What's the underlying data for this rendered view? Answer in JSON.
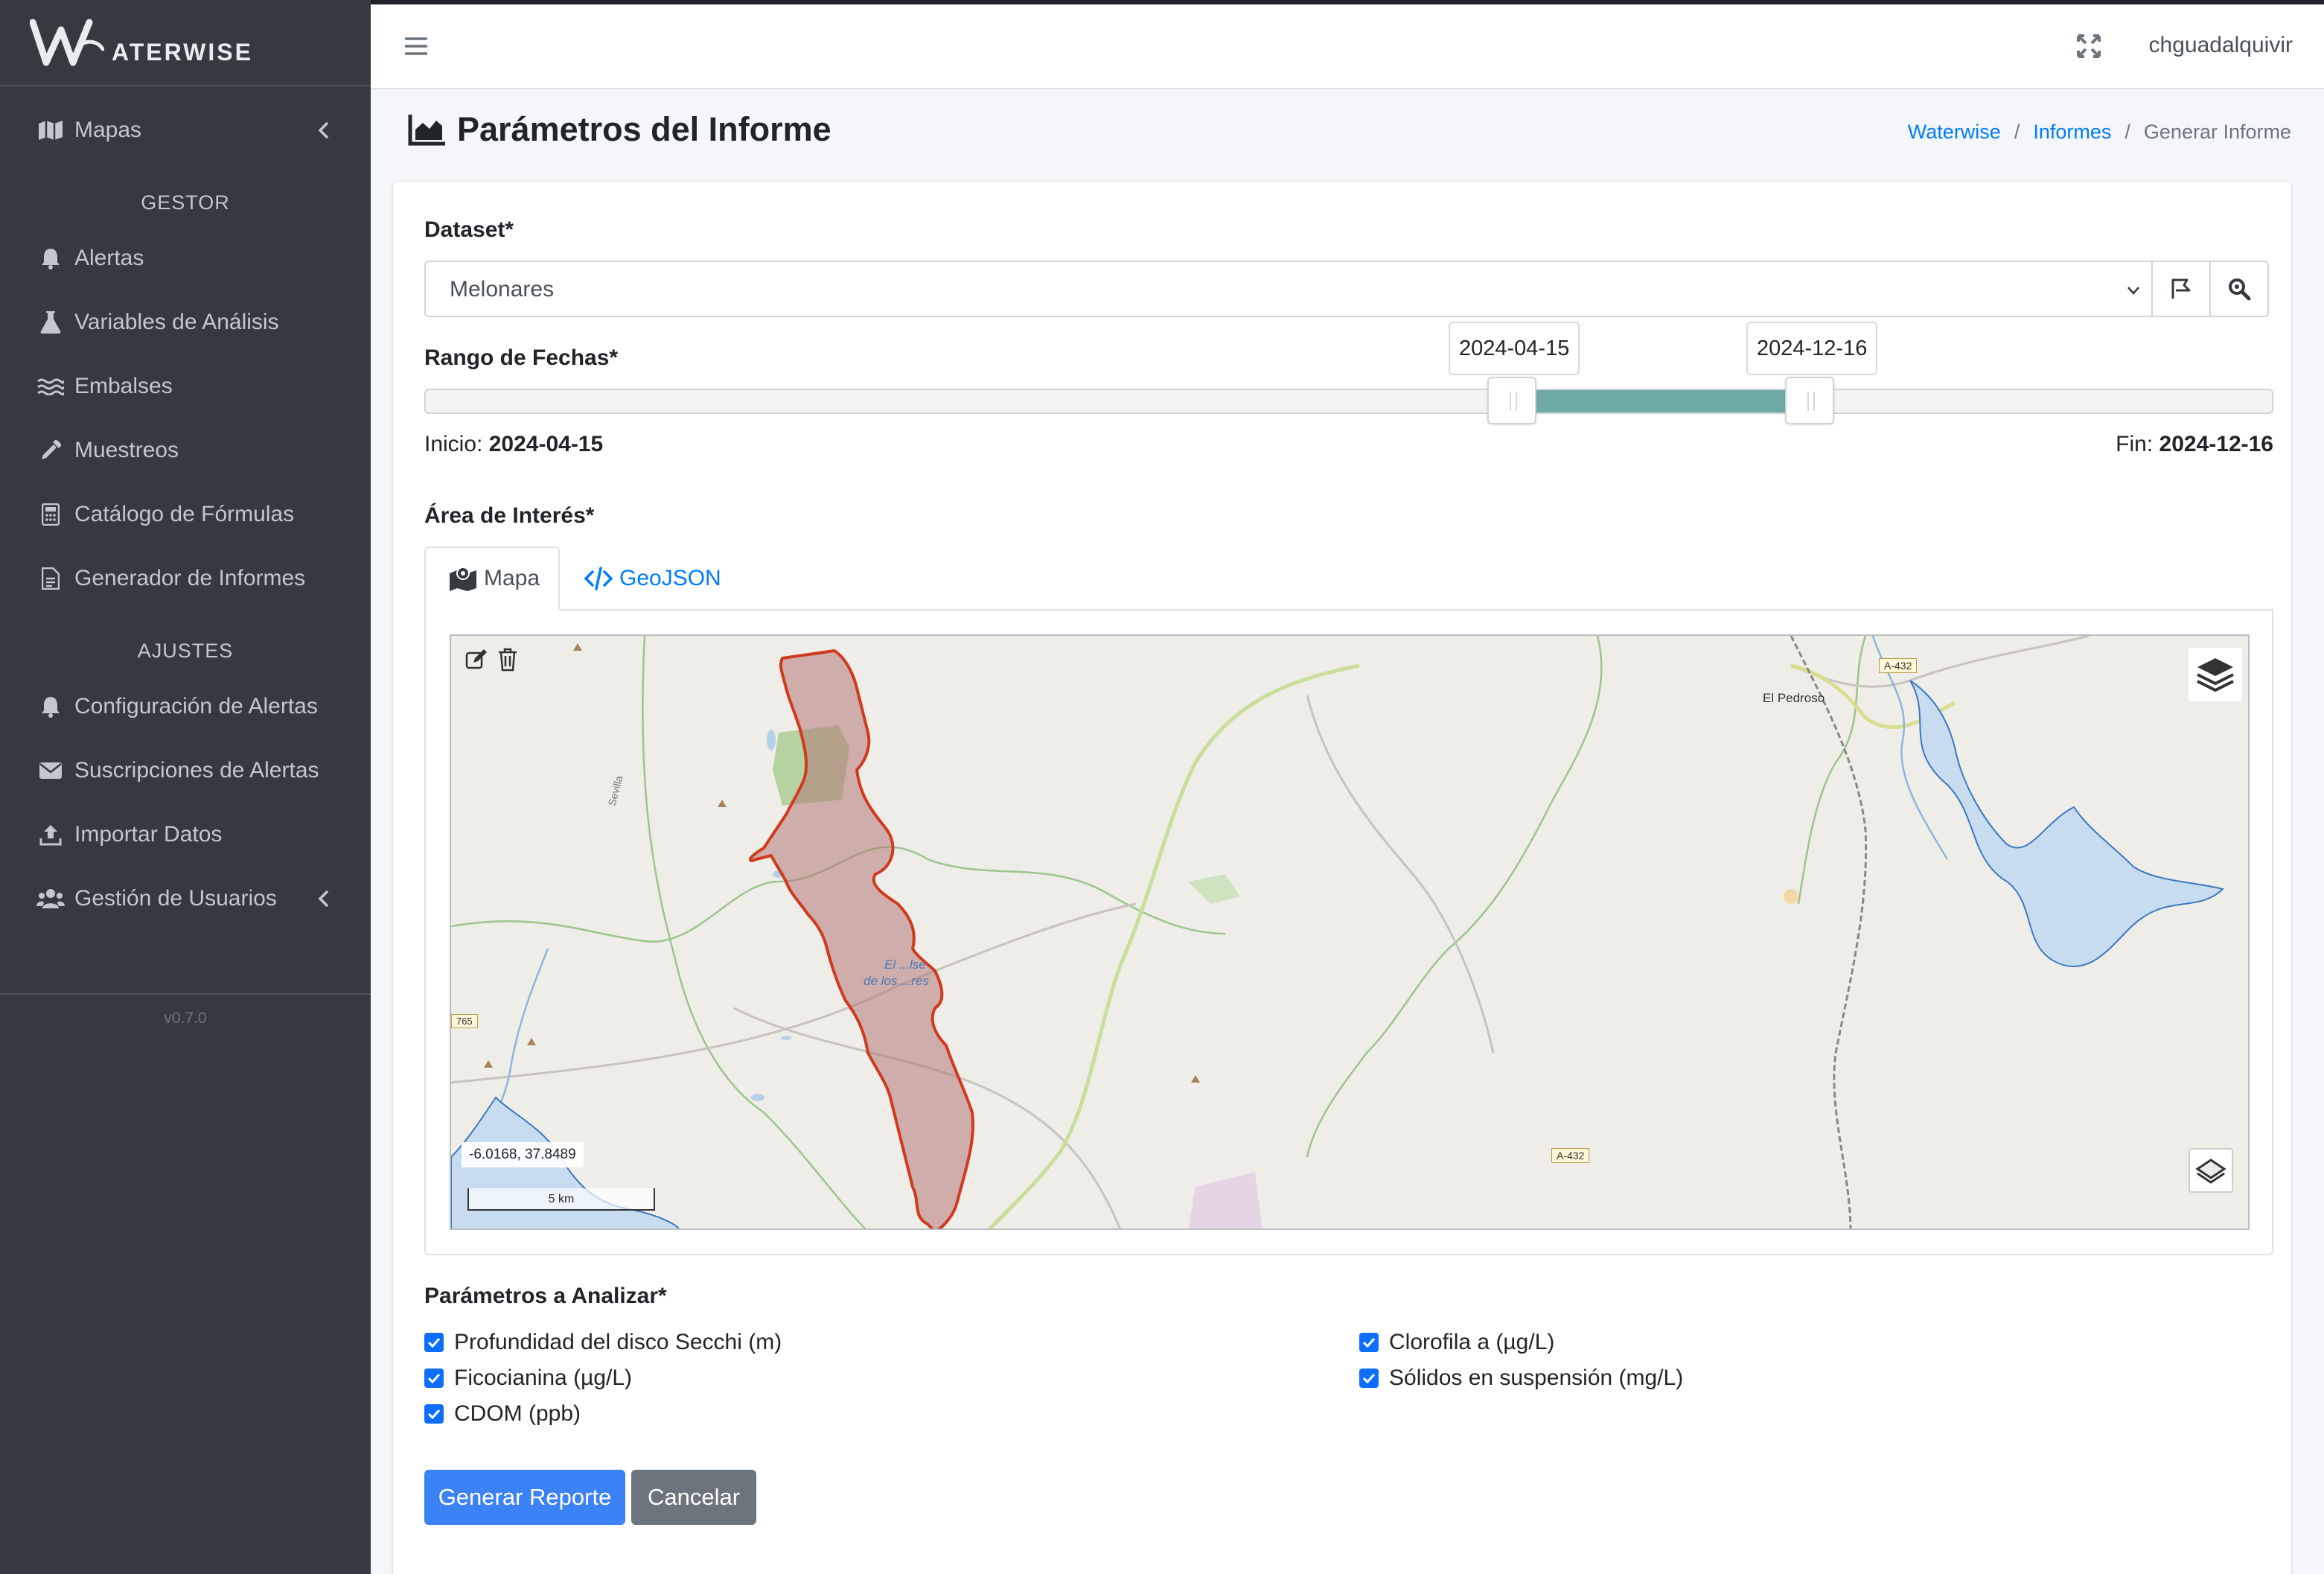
{
  "brand": {
    "name": "ATERWISE"
  },
  "sidebar": {
    "items_top": [
      {
        "label": "Mapas",
        "icon": "map-icon"
      }
    ],
    "section_gestor": "GESTOR",
    "items_gestor": [
      {
        "label": "Alertas",
        "icon": "bell-icon"
      },
      {
        "label": "Variables de Análisis",
        "icon": "flask-icon"
      },
      {
        "label": "Embalses",
        "icon": "water-icon"
      },
      {
        "label": "Muestreos",
        "icon": "eyedropper-icon"
      },
      {
        "label": "Catálogo de Fórmulas",
        "icon": "calculator-icon"
      },
      {
        "label": "Generador de Informes",
        "icon": "file-icon"
      }
    ],
    "section_ajustes": "AJUSTES",
    "items_ajustes": [
      {
        "label": "Configuración de Alertas",
        "icon": "bell-icon"
      },
      {
        "label": "Suscripciones de Alertas",
        "icon": "envelope-icon"
      },
      {
        "label": "Importar Datos",
        "icon": "upload-icon"
      },
      {
        "label": "Gestión de Usuarios",
        "icon": "users-icon"
      }
    ],
    "version": "v0.7.0"
  },
  "navbar": {
    "username": "chguadalquivir"
  },
  "page": {
    "title": "Parámetros del Informe",
    "breadcrumb": [
      "Waterwise",
      "Informes",
      "Generar Informe"
    ]
  },
  "form": {
    "dataset_label": "Dataset*",
    "dataset_value": "Melonares",
    "date_range_label": "Rango de Fechas*",
    "date_start": "2024-04-15",
    "date_end": "2024-12-16",
    "start_prefix": "Inicio:",
    "end_prefix": "Fin:",
    "area_label": "Área de Interés*",
    "tabs": [
      "Mapa",
      "GeoJSON"
    ],
    "params_label": "Parámetros a Analizar*",
    "params": [
      {
        "label": "Profundidad del disco Secchi (m)",
        "checked": true
      },
      {
        "label": "Clorofila a (µg/L)",
        "checked": true
      },
      {
        "label": "Ficocianina (µg/L)",
        "checked": true
      },
      {
        "label": "Sólidos en suspensión (mg/L)",
        "checked": true
      },
      {
        "label": "CDOM (ppb)",
        "checked": true
      }
    ],
    "submit_label": "Generar Reporte",
    "cancel_label": "Cancelar"
  },
  "map": {
    "coords": "-6.0168, 37.8489",
    "scale": "5 km",
    "places": [
      "El Pedroso",
      "Sevilla"
    ],
    "roads": [
      "A-432",
      "A-432"
    ],
    "water_label": "Embalse de los Melonares",
    "water_label_lines": [
      "El ...lse",
      "de los ...res"
    ],
    "road_number": "765",
    "colors": {
      "polygon": "#d03a1f",
      "water": "#c7dcef",
      "range": "#6faaa5"
    }
  }
}
